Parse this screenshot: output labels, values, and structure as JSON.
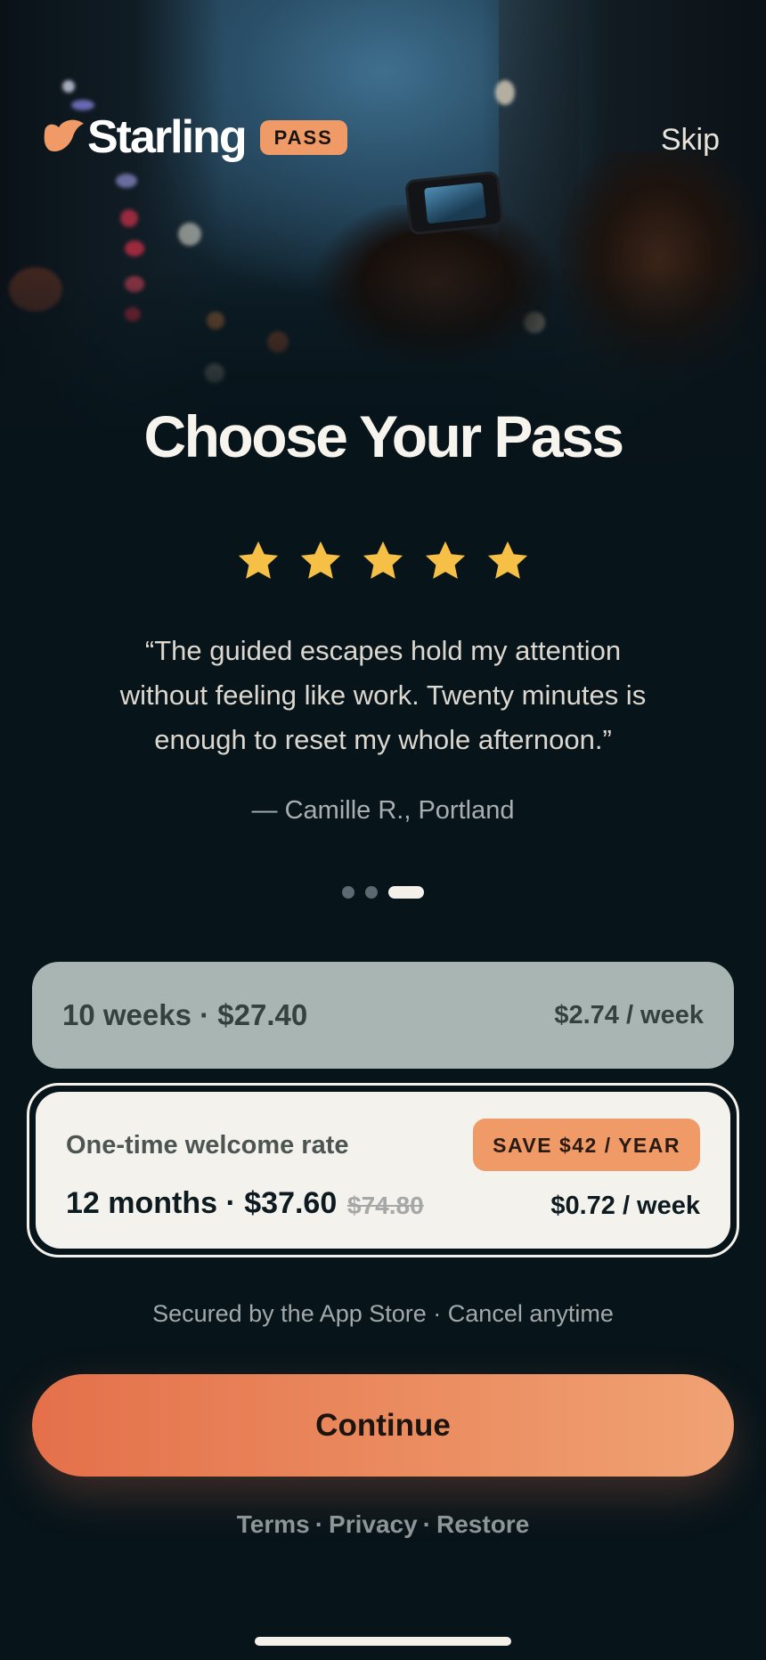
{
  "header": {
    "brand_name": "Starling",
    "badge": "PASS",
    "skip_label": "Skip",
    "logo_icon": "bird-logo-icon"
  },
  "title": "Choose Your Pass",
  "review": {
    "rating": 5,
    "max_rating": 5,
    "quote_line1": "“The guided escapes hold my attention",
    "quote_line2": "without feeling like work. Twenty minutes is",
    "quote_line3": "enough to reset my whole afternoon.”",
    "author": "— Camille R., Portland"
  },
  "carousel": {
    "pages": 3,
    "active_index": 2
  },
  "plans": [
    {
      "title": "10 weeks · $27.40",
      "per_week": "$2.74 / week",
      "selected": false
    },
    {
      "label": "One-time welcome rate",
      "badge": "SAVE $42 / YEAR",
      "title": "12 months · $37.60",
      "original_price": "$74.80",
      "per_week": "$0.72 / week",
      "selected": true
    }
  ],
  "secure_note": "Secured by the App Store · Cancel anytime",
  "cta_label": "Continue",
  "footer_links": {
    "terms": "Terms",
    "privacy": "Privacy",
    "restore": "Restore",
    "separator": "·"
  },
  "colors": {
    "background": "#07141a",
    "accent": "#ef9a67",
    "cta_gradient_start": "#e4704a",
    "cta_gradient_end": "#f0a274",
    "star": "#f6bf45",
    "plan_unselected_bg": "#a9b5b2",
    "plan_selected_bg": "#f3f2ec"
  }
}
